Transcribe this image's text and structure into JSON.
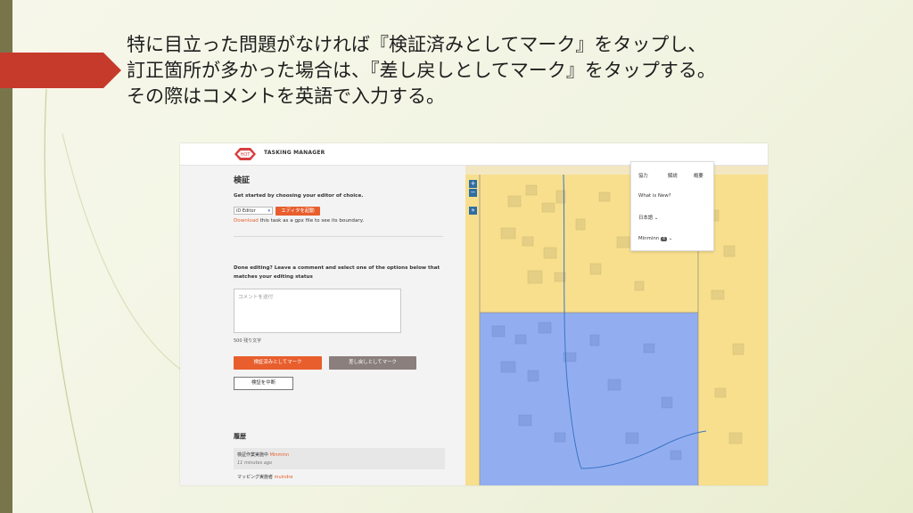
{
  "slide": {
    "instruction_lines": [
      "特に目立った問題がなければ『検証済みとしてマーク』をタップし、",
      "訂正箇所が多かった場合は、『差し戻しとしてマーク』をタップする。",
      "その際はコメントを英語で入力する。"
    ],
    "accent_colors": {
      "bar": "#79754a",
      "arrow": "#c63a2b"
    }
  },
  "app": {
    "brand": "TASKING MANAGER",
    "logo_text": "HOT",
    "panel": {
      "title": "検証",
      "start_text": "Get started by choosing your editor of choice.",
      "editor_select": "iD Editor",
      "launch_button": "エディタを起動",
      "download_link": "Download",
      "download_rest": " this task as a gpx file to see its boundary.",
      "done_text_line1": "Done editing? Leave a comment and select one of the options below that",
      "done_text_line2": "matches your editing status",
      "comment_placeholder": "コメントを送付",
      "char_count": "500 残り文字",
      "validate_button": "検証済みとしてマーク",
      "invalidate_button": "差し戻しとしてマーク",
      "stop_button": "検証を中断",
      "history_title": "履歴",
      "history": [
        {
          "action": "検証作業実施中",
          "user": "Minminn",
          "time": "11 minutes ago"
        },
        {
          "action": "マッピング実施者",
          "user": "muindre",
          "time": ""
        }
      ]
    },
    "menu": {
      "tabs": [
        "協力",
        "解説",
        "概要"
      ],
      "whats_new": "What is New?",
      "language": "日本語",
      "user": "Minminn",
      "user_badge": "4"
    },
    "map": {
      "colors": {
        "yellow": "#f7df8e",
        "blue": "#93aef0",
        "line": "#3b74c6"
      }
    }
  }
}
